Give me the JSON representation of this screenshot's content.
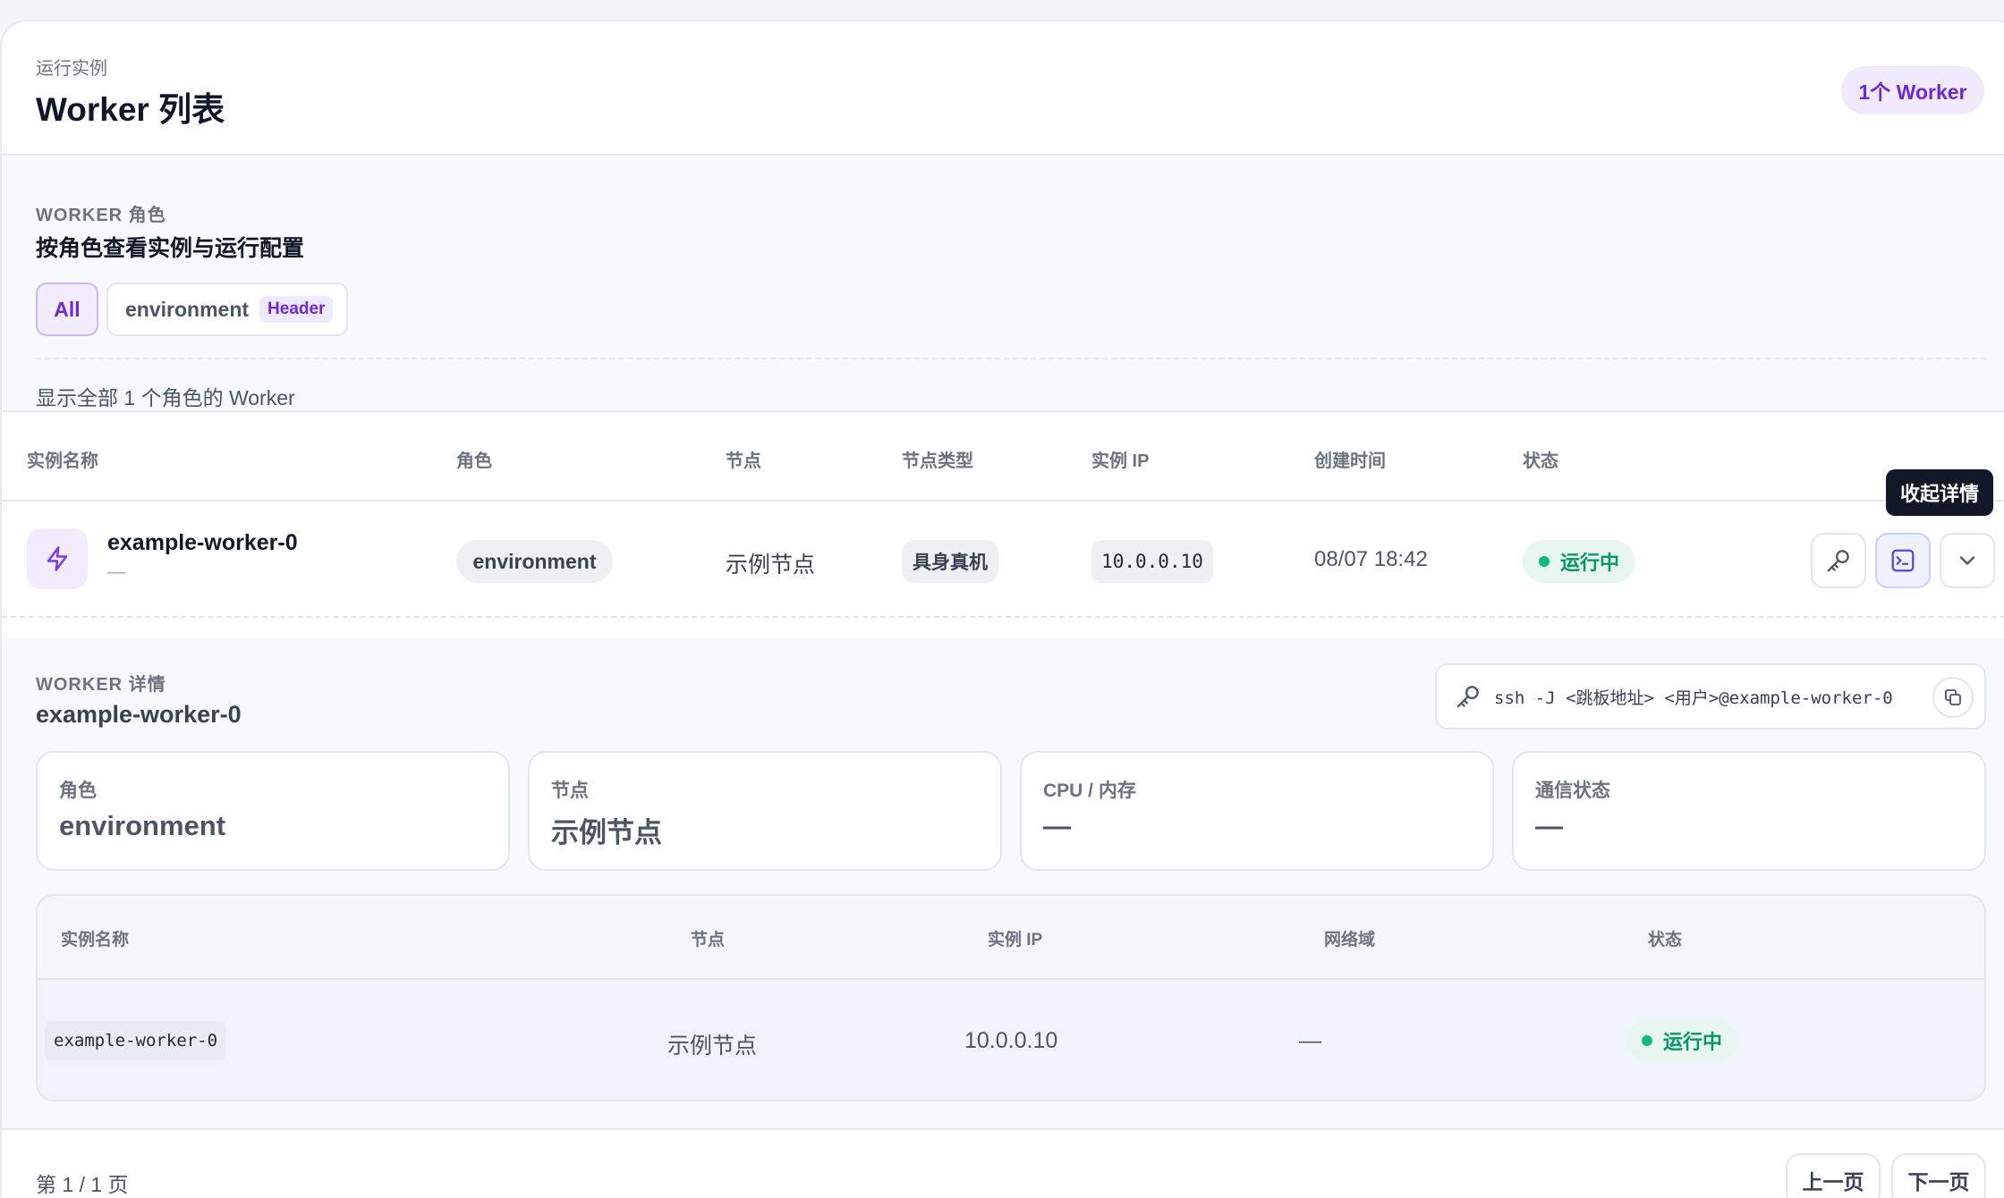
{
  "header": {
    "eyebrow": "运行实例",
    "title": "Worker 列表",
    "count_badge": "1个 Worker"
  },
  "roles": {
    "eyebrow": "WORKER 角色",
    "title": "按角色查看实例与运行配置",
    "chips": [
      {
        "label": "All",
        "active": true
      },
      {
        "label": "environment",
        "tag": "Header",
        "active": false
      }
    ],
    "summary": "显示全部 1 个角色的 Worker"
  },
  "table": {
    "columns": [
      "实例名称",
      "角色",
      "节点",
      "节点类型",
      "实例 IP",
      "创建时间",
      "状态"
    ],
    "rows": [
      {
        "name": "example-worker-0",
        "subtitle": "—",
        "role": "environment",
        "node": "示例节点",
        "node_type": "具身真机",
        "ip": "10.0.0.10",
        "created": "08/07 18:42",
        "status": "运行中"
      }
    ],
    "actions": [
      "key-icon",
      "terminal-icon",
      "chevron-down-icon"
    ]
  },
  "tooltip": "收起详情",
  "detail": {
    "eyebrow": "WORKER 详情",
    "name": "example-worker-0",
    "ssh_command": "ssh -J <跳板地址> <用户>@example-worker-0",
    "stats": [
      {
        "label": "角色",
        "value": "environment"
      },
      {
        "label": "节点",
        "value": "示例节点"
      },
      {
        "label": "CPU / 内存",
        "value": "—"
      },
      {
        "label": "通信状态",
        "value": "—"
      }
    ],
    "instances": {
      "columns": [
        "实例名称",
        "节点",
        "实例 IP",
        "网络域",
        "状态"
      ],
      "rows": [
        {
          "name": "example-worker-0",
          "node": "示例节点",
          "ip": "10.0.0.10",
          "domain": "—",
          "status": "运行中"
        }
      ]
    }
  },
  "pagination": {
    "info": "第 1 / 1 页",
    "prev": "上一页",
    "next": "下一页"
  },
  "colors": {
    "accent": "#6d28d9",
    "accent_bg": "#efeafe",
    "success": "#059669",
    "success_bg": "#e7f7ee"
  }
}
